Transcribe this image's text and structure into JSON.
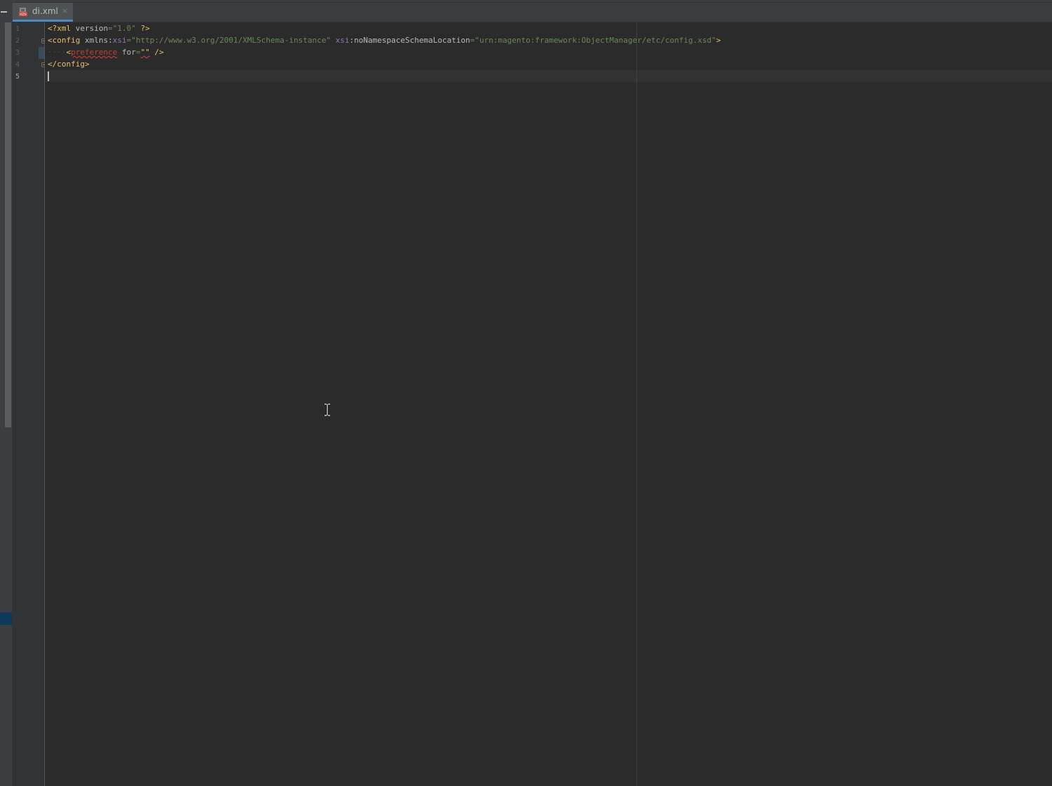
{
  "tab": {
    "file_name": "di.xml",
    "close_symbol": "×",
    "icon": "xml-file-icon"
  },
  "gutter": {
    "line_numbers": [
      "1",
      "2",
      "3",
      "4",
      "5"
    ]
  },
  "code": {
    "line1": {
      "open": "<?xml ",
      "attr": "version",
      "eq": "=",
      "value": "\"1.0\"",
      "close": " ?>"
    },
    "line2": {
      "open": "<config ",
      "attr1_name": "xmlns",
      "attr1_colon": ":",
      "attr1_ns": "xsi",
      "attr1_eq": "=",
      "attr1_value": "\"http://www.w3.org/2001/XMLSchema-instance\"",
      "space": " ",
      "attr2_ns": "xsi",
      "attr2_name": ":noNamespaceSchemaLocation",
      "attr2_eq": "=",
      "attr2_value": "\"urn:magento:framework:ObjectManager/etc/config.xsd\"",
      "close": ">"
    },
    "line3": {
      "indent": "····",
      "open": "<",
      "tag": "preference",
      "attr": " for",
      "eq": "=",
      "value": "\"\"",
      "close": " />"
    },
    "line4": {
      "text": "</config>"
    }
  },
  "colors": {
    "background": "#2b2b2b",
    "gutter": "#313335",
    "tab_underline": "#4a88c7",
    "tag": "#e8bf6a",
    "string": "#6a8759",
    "namespace": "#9876aa",
    "error": "#bc3f3c"
  }
}
